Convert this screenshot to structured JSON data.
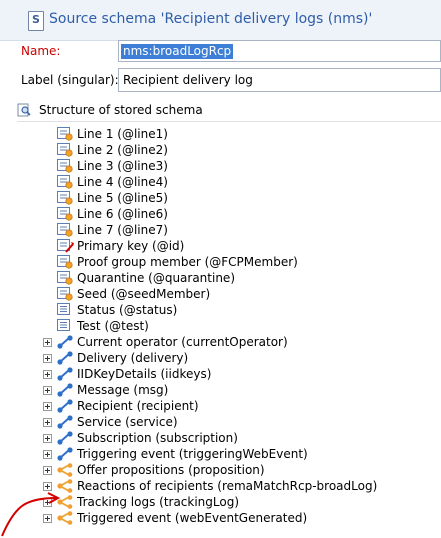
{
  "window": {
    "title": "Source schema 'Recipient delivery logs (nms)'"
  },
  "form": {
    "name_label": "Name:",
    "name_value": "nms:broadLogRcp",
    "label_label": "Label (singular):",
    "label_value": "Recipient delivery log"
  },
  "structure": {
    "header": "Structure of stored schema",
    "attributes": [
      {
        "label": "Line 1 (@line1)",
        "icon": "attribute-icon"
      },
      {
        "label": "Line 2 (@line2)",
        "icon": "attribute-icon"
      },
      {
        "label": "Line 3 (@line3)",
        "icon": "attribute-icon"
      },
      {
        "label": "Line 4 (@line4)",
        "icon": "attribute-icon"
      },
      {
        "label": "Line 5 (@line5)",
        "icon": "attribute-icon"
      },
      {
        "label": "Line 6 (@line6)",
        "icon": "attribute-icon"
      },
      {
        "label": "Line 7 (@line7)",
        "icon": "attribute-icon"
      },
      {
        "label": "Primary key (@id)",
        "icon": "primary-key-icon"
      },
      {
        "label": "Proof group member (@FCPMember)",
        "icon": "attribute-icon"
      },
      {
        "label": "Quarantine (@quarantine)",
        "icon": "attribute-icon"
      },
      {
        "label": "Seed (@seedMember)",
        "icon": "attribute-icon"
      },
      {
        "label": "Status (@status)",
        "icon": "enum-icon"
      },
      {
        "label": "Test (@test)",
        "icon": "enum-icon"
      }
    ],
    "links": [
      {
        "label": "Current operator (currentOperator)",
        "icon": "link-icon"
      },
      {
        "label": "Delivery (delivery)",
        "icon": "link-icon"
      },
      {
        "label": "IIDKeyDetails (iidkeys)",
        "icon": "link-icon"
      },
      {
        "label": "Message (msg)",
        "icon": "link-icon"
      },
      {
        "label": "Recipient (recipient)",
        "icon": "link-icon"
      },
      {
        "label": "Service (service)",
        "icon": "link-icon"
      },
      {
        "label": "Subscription (subscription)",
        "icon": "link-icon"
      },
      {
        "label": "Triggering event (triggeringWebEvent)",
        "icon": "link-icon"
      },
      {
        "label": "Offer propositions (proposition)",
        "icon": "collection-link-icon"
      },
      {
        "label": "Reactions of recipients (remaMatchRcp-broadLog)",
        "icon": "collection-link-icon"
      },
      {
        "label": "Tracking logs (trackingLog)",
        "icon": "collection-link-icon"
      },
      {
        "label": "Triggered event (webEventGenerated)",
        "icon": "collection-link-icon"
      }
    ]
  },
  "colors": {
    "title": "#2f5da8",
    "required_label": "#cc0000",
    "selection": "#3d7fd7",
    "link_icon": "#2f6fc6",
    "collection_icon": "#f0a030",
    "annotation": "#d40000"
  }
}
